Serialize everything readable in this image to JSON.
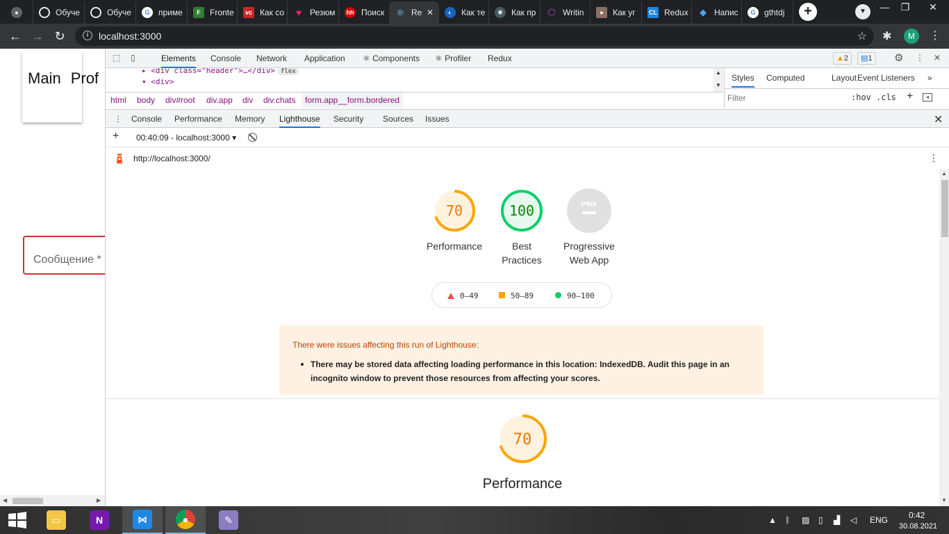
{
  "tabs": [
    {
      "title": "",
      "icon": "chrome-icon",
      "fav_color": "#5f6368"
    },
    {
      "title": "Обуче",
      "icon": "openai-icon",
      "fav_color": "#5f6368"
    },
    {
      "title": "Обуче",
      "icon": "openai-icon",
      "fav_color": "#5f6368"
    },
    {
      "title": "приме",
      "icon": "google-icon",
      "fav_color": "#4285f4"
    },
    {
      "title": "Fronte",
      "icon": "site-icon",
      "fav_color": "#2e7d32"
    },
    {
      "title": "Как со",
      "icon": "vc-icon",
      "fav_color": "#c62828"
    },
    {
      "title": "Резюм",
      "icon": "heart-icon",
      "fav_color": "#c2185b"
    },
    {
      "title": "Поиск",
      "icon": "hh-icon",
      "fav_color": "#d50000"
    },
    {
      "title": "Re",
      "icon": "react-icon",
      "fav_color": "#00b7d4"
    },
    {
      "title": "Как те",
      "icon": "site-icon",
      "fav_color": "#1565c0"
    },
    {
      "title": "Как пр",
      "icon": "site-icon",
      "fav_color": "#455a64"
    },
    {
      "title": "Writin",
      "icon": "graphql-icon",
      "fav_color": "#7b1fa2"
    },
    {
      "title": "Как уг",
      "icon": "avatar-icon",
      "fav_color": "#8d6e63"
    },
    {
      "title": "Redux",
      "icon": "cl-icon",
      "fav_color": "#1e88e5"
    },
    {
      "title": "Напис",
      "icon": "stack-icon",
      "fav_color": "#1976d2"
    },
    {
      "title": "gthtdj",
      "icon": "google-icon",
      "fav_color": "#4285f4"
    }
  ],
  "address": {
    "url": "localhost:3000",
    "avatar_letter": "M"
  },
  "page": {
    "nav_items": [
      "Main",
      "Prof"
    ],
    "message_placeholder": "Сообщение *"
  },
  "devtools": {
    "main_tabs": [
      "Elements",
      "Console",
      "Network",
      "Application",
      "Components",
      "Profiler",
      "Redux"
    ],
    "warn_count": "2",
    "msg_count": "1",
    "elements_lines": [
      "<div class=\"header\">…</div>",
      "<div>"
    ],
    "flex_badge": "flex",
    "breadcrumbs": [
      "html",
      "body",
      "div#root",
      "div.app",
      "div",
      "div.chats",
      "form.app__form.bordered"
    ],
    "styles_tabs": [
      "Styles",
      "Computed",
      "Layout",
      "Event Listeners"
    ],
    "filter_placeholder": "Filter",
    "hov": ":hov",
    "cls": ".cls",
    "drawer_tabs": [
      "Console",
      "Performance",
      "Memory",
      "Lighthouse",
      "Security",
      "Sources",
      "Issues"
    ],
    "report_select": "00:40:09 - localhost:3000"
  },
  "lighthouse": {
    "url": "http://localhost:3000/",
    "gauges": [
      {
        "score": "70",
        "value": 0.7,
        "label_lines": [
          "Performance"
        ],
        "color": "#ffa400",
        "fill": "#fff3e0"
      },
      {
        "score": "100",
        "value": 1.0,
        "label_lines": [
          "Best",
          "Practices"
        ],
        "color": "#0cce6b",
        "fill": "#e6f9ee"
      },
      {
        "score": "PWA",
        "value": 0,
        "label_lines": [
          "Progressive",
          "Web App"
        ],
        "color": "#ddd",
        "fill": "#e8e8e8"
      }
    ],
    "legend": [
      "0–49",
      "50–89",
      "90–100"
    ],
    "warning_title": "There were issues affecting this run of Lighthouse:",
    "warning_item": "There may be stored data affecting loading performance in this location: IndexedDB. Audit this page in an incognito window to prevent those resources from affecting your scores.",
    "section_score": "70",
    "section_value": 0.7,
    "section_label": "Performance"
  },
  "taskbar": {
    "lang": "ENG",
    "time": "0:42",
    "date": "30.08.2021"
  },
  "colors": {
    "accent": "#1a73e8",
    "warning_bg": "#fef1e3",
    "error_border": "#d32f2f"
  }
}
